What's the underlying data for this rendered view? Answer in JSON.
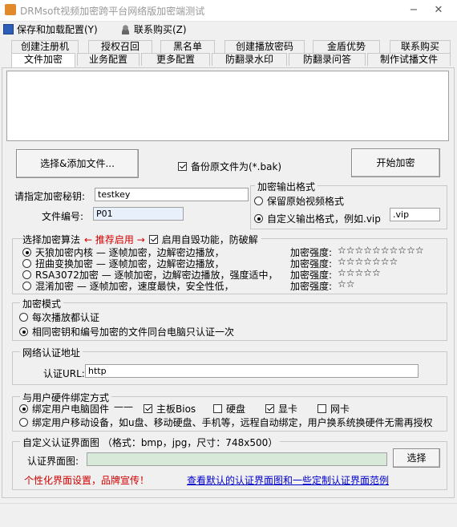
{
  "window": {
    "title": "DRMsoft视频加密跨平台网络版加密端测试",
    "minimize": "−",
    "close": "✕"
  },
  "menu": {
    "save_load": "保存和加载配置(Y)",
    "contact": "联系购买(Z)"
  },
  "tabs_row1": [
    "创建注册机",
    "授权召回",
    "黑名单",
    "创建播放密码",
    "金盾优势",
    "联系购买"
  ],
  "tabs_row2": [
    "文件加密",
    "业务配置",
    "更多配置",
    "防翻录水印",
    "防翻录问答",
    "制作试播文件"
  ],
  "buttons": {
    "select_files": "选择&添加文件...",
    "start_encrypt": "开始加密",
    "select": "选择"
  },
  "backup": {
    "label": "备份原文件为(*.bak)",
    "checked": true
  },
  "key": {
    "label": "请指定加密秘钥:",
    "value": "testkey"
  },
  "file_no": {
    "label": "文件编号:",
    "value": "P01"
  },
  "output_format": {
    "title": "加密输出格式",
    "keep_label": "保留原始视频格式",
    "custom_label": "自定义输出格式，例如.vip",
    "custom_value": ".vip"
  },
  "algorithm": {
    "title": "选择加密算法",
    "recommend": "← 推荐启用 →",
    "self_destroy": "启用自毁功能，防破解",
    "items": [
      {
        "label": "天狼加密内核 — 逐帧加密，边解密边播放，",
        "strength_label": "加密强度:",
        "stars": "☆☆☆☆☆☆☆☆☆☆"
      },
      {
        "label": "扭曲变换加密 — 逐帧加密，边解密边播放，",
        "strength_label": "加密强度:",
        "stars": "☆☆☆☆☆☆☆"
      },
      {
        "label": "RSA3072加密 — 逐帧加密，边解密边播放，强度适中，",
        "strength_label": "加密强度:",
        "stars": "☆☆☆☆☆"
      },
      {
        "label": "混淆加密 — 逐帧加密，速度最快，安全性低，",
        "strength_label": "加密强度:",
        "stars": "☆☆"
      }
    ]
  },
  "mode": {
    "title": "加密模式",
    "opt1": "每次播放都认证",
    "opt2": "相同密钥和编号加密的文件同台电脑只认证一次"
  },
  "network": {
    "title": "网络认证地址",
    "label": "认证URL:",
    "value": "http"
  },
  "hardware": {
    "title": "与用户硬件绑定方式",
    "bind_pc": "绑定用户电脑固件",
    "dash": "——",
    "mainboard": "主板Bios",
    "disk": "硬盘",
    "gpu": "显卡",
    "nic": "网卡",
    "bind_mobile": "绑定用户移动设备，如u盘、移动硬盘、手机等，远程自动绑定，用户换系统换硬件无需再授权"
  },
  "custom_ui": {
    "title": "自定义认证界面图 （格式：bmp，jpg，尺寸：748x500）",
    "label": "认证界面图:",
    "value": "",
    "promo": "个性化界面设置，品牌宣传！",
    "link": "查看默认的认证界面图和一些定制认证界面范例"
  }
}
